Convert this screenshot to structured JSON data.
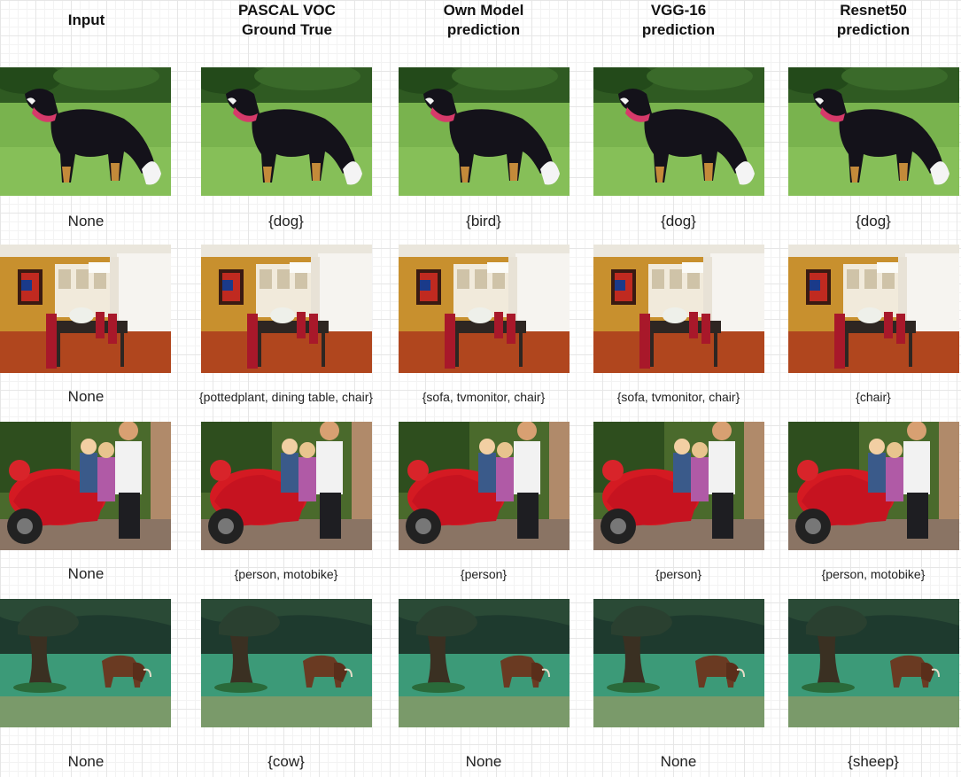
{
  "headers": [
    "Input",
    "PASCAL VOC\nGround True",
    "Own Model\nprediction",
    "VGG-16\nprediction",
    "Resnet50\nprediction"
  ],
  "rows": [
    {
      "scene": "dog",
      "labels": [
        "None",
        "{dog}",
        "{bird}",
        "{dog}",
        "{dog}"
      ]
    },
    {
      "scene": "dining-room",
      "labels": [
        "None",
        "{pottedplant, dining table, chair}",
        "{sofa, tvmonitor, chair}",
        "{sofa, tvmonitor, chair}",
        "{chair}"
      ]
    },
    {
      "scene": "motorbike",
      "labels": [
        "None",
        "{person, motobike}",
        "{person}",
        "{person}",
        "{person, motobike}"
      ]
    },
    {
      "scene": "cow",
      "labels": [
        "None",
        "{cow}",
        "None",
        "None",
        "{sheep}"
      ]
    }
  ]
}
